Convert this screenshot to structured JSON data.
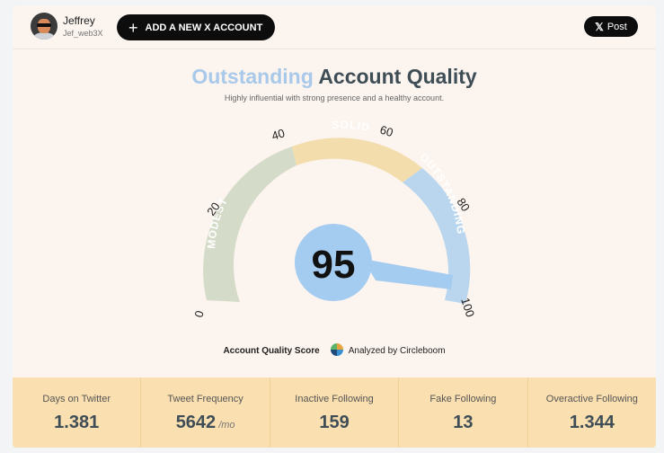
{
  "header": {
    "user_name": "Jeffrey",
    "user_handle": "Jef_web3X",
    "add_account_label": "ADD A NEW X ACCOUNT",
    "post_label": "Post"
  },
  "quality": {
    "title_highlight": "Outstanding",
    "title_rest": "Account Quality",
    "subtitle": "Highly influential with strong presence and a healthy account.",
    "score": "95",
    "score_value": 95,
    "bands": [
      "MODEST",
      "SOLID",
      "OUTSTANDING"
    ],
    "ticks": [
      "0",
      "20",
      "40",
      "60",
      "80",
      "100"
    ],
    "colors": {
      "modest": "#d5dbc9",
      "solid": "#f3ddac",
      "outstanding": "#b9d6ee",
      "score_bubble": "#a4cbf0",
      "title_highlight": "#a9c9ea"
    }
  },
  "legend": {
    "score_label": "Account Quality Score",
    "analyzed_by": "Analyzed by Circleboom"
  },
  "stats": [
    {
      "label": "Days on Twitter",
      "value": "1.381",
      "unit": ""
    },
    {
      "label": "Tweet Frequency",
      "value": "5642",
      "unit": "/mo"
    },
    {
      "label": "Inactive Following",
      "value": "159",
      "unit": ""
    },
    {
      "label": "Fake Following",
      "value": "13",
      "unit": ""
    },
    {
      "label": "Overactive Following",
      "value": "1.344",
      "unit": ""
    }
  ]
}
